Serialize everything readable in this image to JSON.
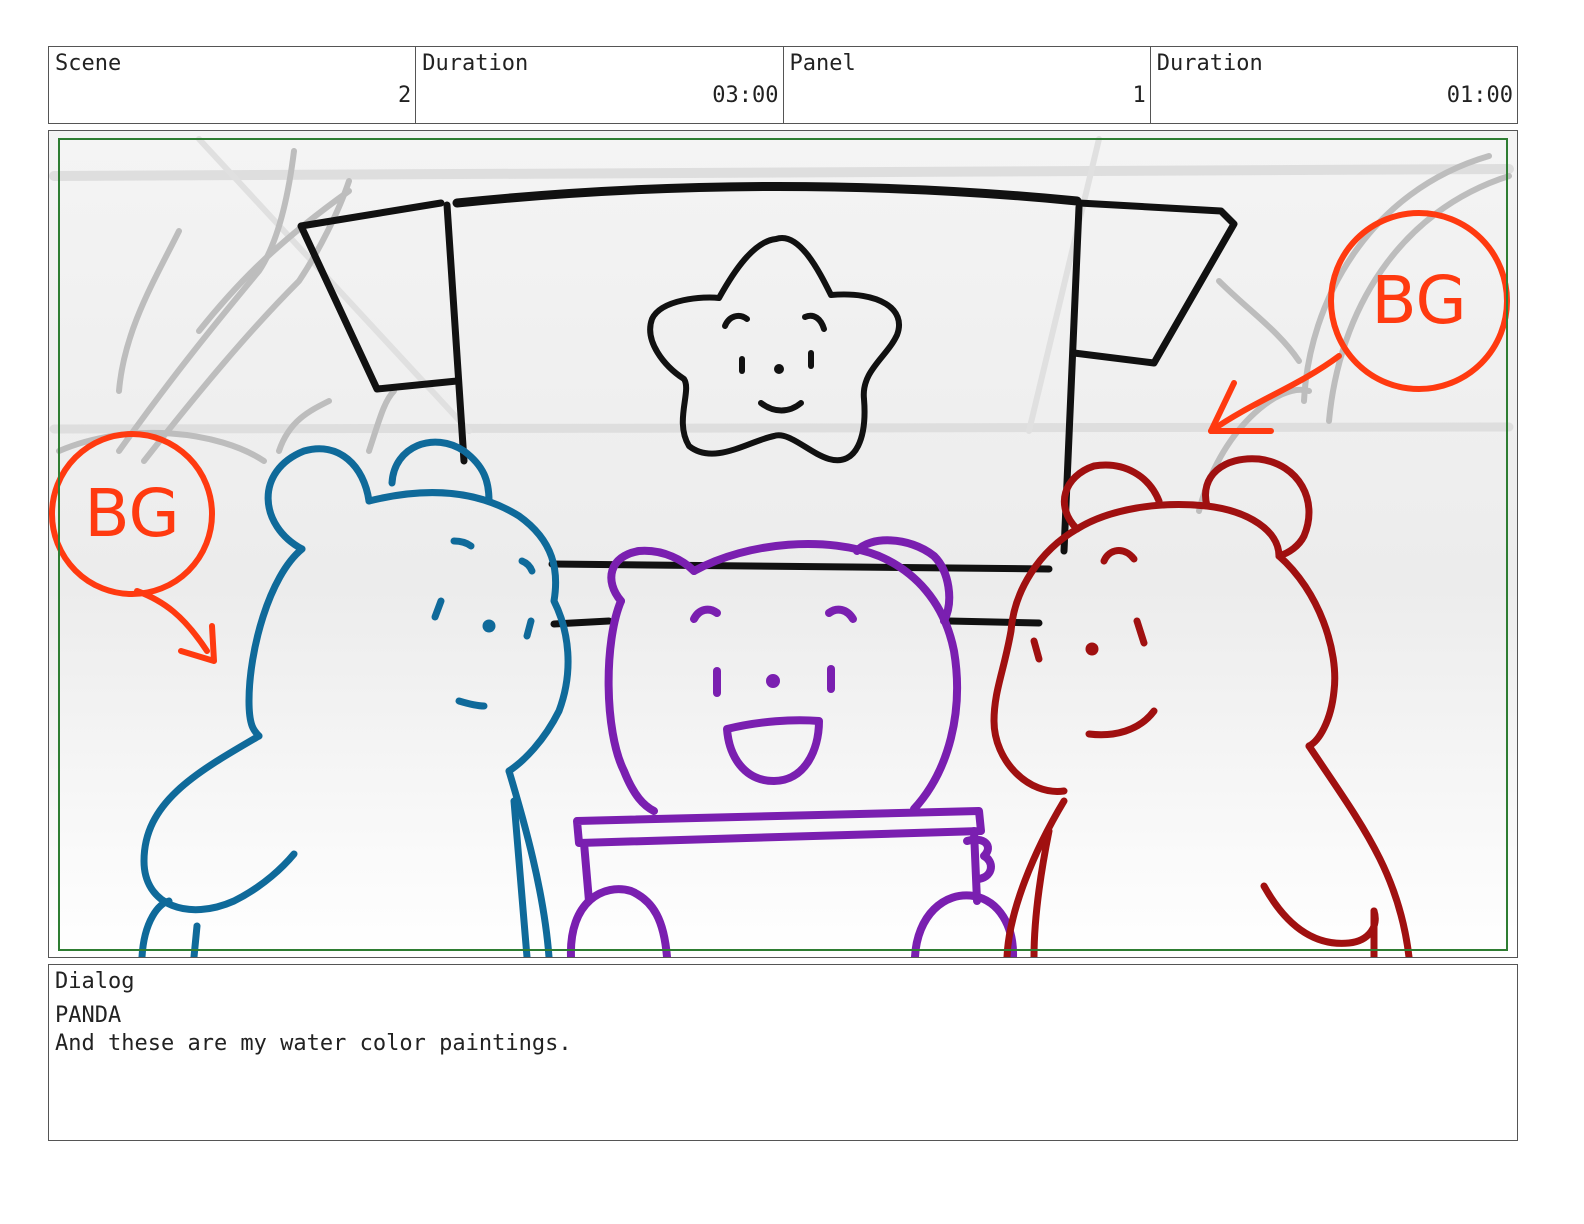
{
  "header": {
    "scene_label": "Scene",
    "scene_value": "2",
    "scene_duration_label": "Duration",
    "scene_duration_value": "03:00",
    "panel_label": "Panel",
    "panel_value": "1",
    "panel_duration_label": "Duration",
    "panel_duration_value": "01:00"
  },
  "panel": {
    "annotation_left": "BG",
    "annotation_right": "BG",
    "colors": {
      "frame": "#2e7d32",
      "annotation": "#ff3a10",
      "blue_bear": "#0f6a9a",
      "panda": "#7a1fb0",
      "red_bear": "#a01010",
      "sign": "#111111",
      "background_sketch": "#bdbdbd"
    }
  },
  "dialog": {
    "label": "Dialog",
    "speaker": "PANDA",
    "line": "And these are my water color paintings."
  }
}
